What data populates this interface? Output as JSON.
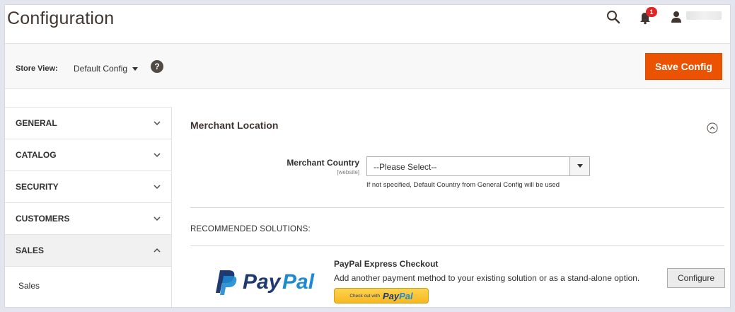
{
  "header": {
    "title": "Configuration",
    "notification_count": "1"
  },
  "store_bar": {
    "label": "Store View:",
    "selected_scope": "Default Config",
    "help_glyph": "?",
    "save_label": "Save Config"
  },
  "sidebar": {
    "items": [
      {
        "label": "GENERAL",
        "state": "collapsed"
      },
      {
        "label": "CATALOG",
        "state": "collapsed"
      },
      {
        "label": "SECURITY",
        "state": "collapsed"
      },
      {
        "label": "CUSTOMERS",
        "state": "collapsed"
      },
      {
        "label": "SALES",
        "state": "expanded"
      }
    ],
    "sales_subitems": [
      "Sales"
    ]
  },
  "main": {
    "section_title": "Merchant Location",
    "merchant_country": {
      "label": "Merchant Country",
      "scope": "[website]",
      "value": "--Please Select--",
      "note": "If not specified, Default Country from General Config will be used"
    },
    "recommended_title": "RECOMMENDED SOLUTIONS:",
    "paypal": {
      "logo_text_pay": "Pay",
      "logo_text_pal": "Pal",
      "title": "PayPal Express Checkout",
      "description": "Add another payment method to your existing solution or as a stand-alone option.",
      "checkout_small": "Check out with",
      "checkout_pay": "Pay",
      "checkout_pal": "Pal",
      "configure_label": "Configure"
    }
  },
  "colors": {
    "accent": "#eb5202",
    "paypal_dark": "#1f3a70",
    "paypal_light": "#1e8ad0",
    "badge": "#e22626"
  }
}
